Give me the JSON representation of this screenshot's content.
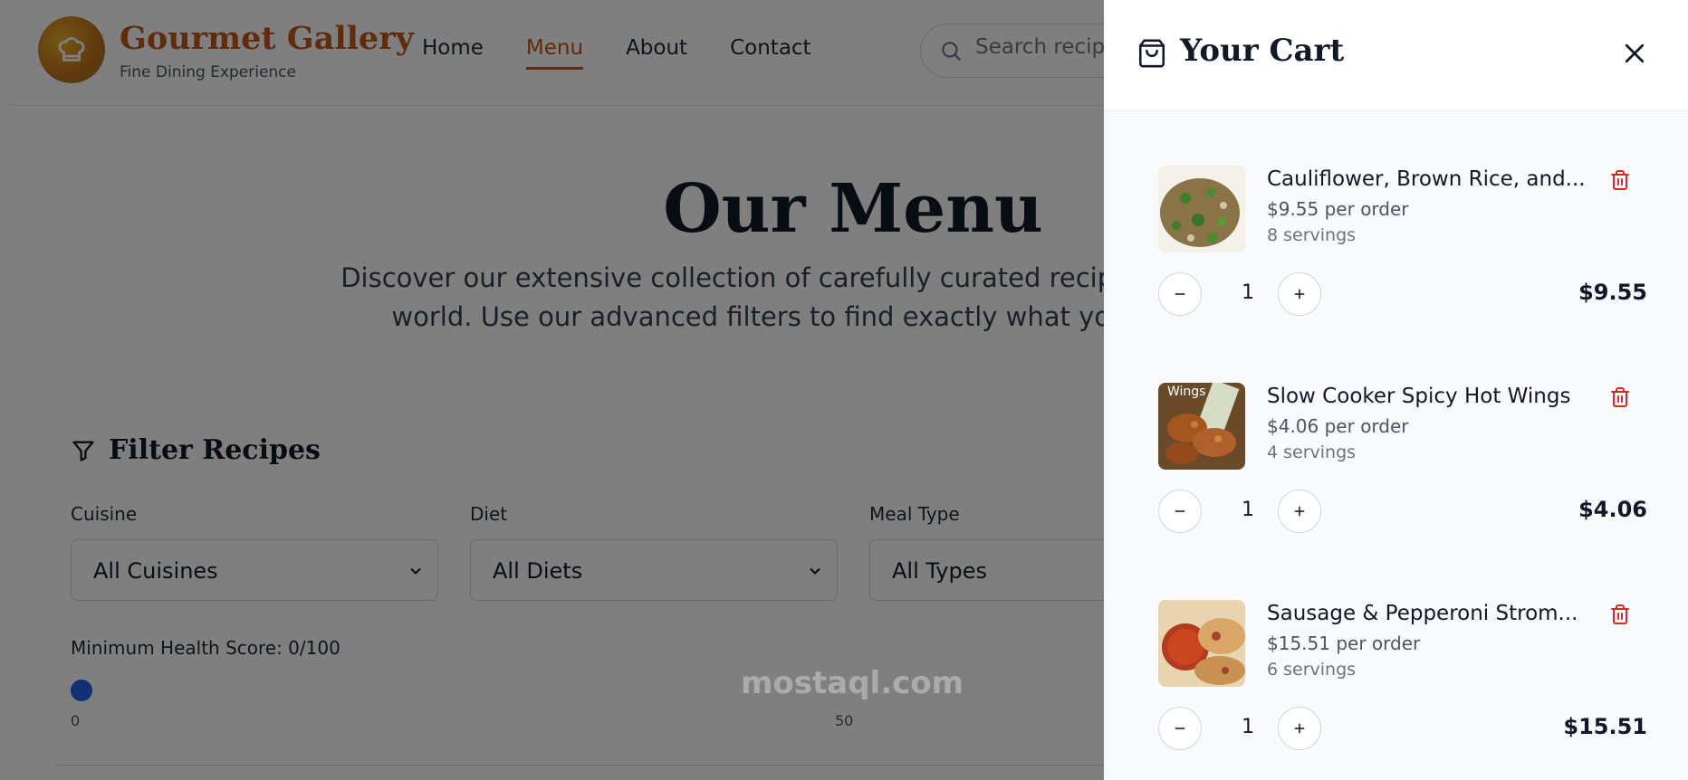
{
  "brand": {
    "name": "Gourmet Gallery",
    "tagline": "Fine Dining Experience"
  },
  "nav": {
    "items": [
      "Home",
      "Menu",
      "About",
      "Contact"
    ],
    "active": "Menu"
  },
  "search": {
    "placeholder": "Search recipes..."
  },
  "hero": {
    "title": "Our Menu",
    "subtitle": "Discover our extensive collection of carefully curated recipes from around the world. Use our advanced filters to find exactly what you're looking for."
  },
  "filters": {
    "title": "Filter Recipes",
    "cuisine": {
      "label": "Cuisine",
      "value": "All Cuisines"
    },
    "diet": {
      "label": "Diet",
      "value": "All Diets"
    },
    "meal_type": {
      "label": "Meal Type",
      "value": "All Types"
    },
    "health_label": "Minimum Health Score: 0/100",
    "slider_min": "0",
    "slider_mid": "50"
  },
  "cart": {
    "title": "Your Cart",
    "items": [
      {
        "name": "Cauliflower, Brown Rice, and...",
        "price": "$9.55 per order",
        "servings": "8 servings",
        "qty": "1",
        "total": "$9.55",
        "thumb_color": "#7a6a3a"
      },
      {
        "name": "Slow Cooker Spicy Hot Wings",
        "price": "$4.06 per order",
        "servings": "4 servings",
        "qty": "1",
        "total": "$4.06",
        "thumb_color": "#9a5a2a",
        "thumb_label": "Wings"
      },
      {
        "name": "Sausage & Pepperoni Strom...",
        "price": "$15.51 per order",
        "servings": "6 servings",
        "qty": "1",
        "total": "$15.51",
        "thumb_color": "#b0502a"
      }
    ]
  },
  "watermark": "mostaql.com",
  "colors": {
    "accent": "#c2571c",
    "slider": "#2563eb",
    "trash": "#dc2626"
  }
}
